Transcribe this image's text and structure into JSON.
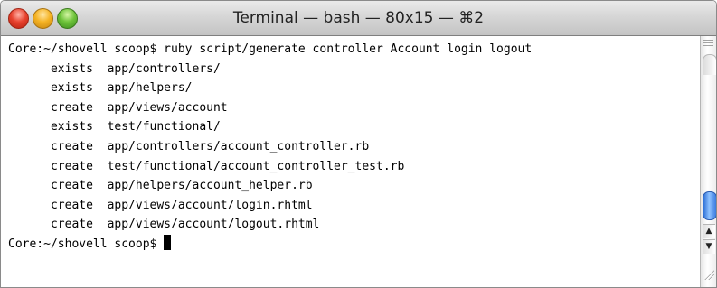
{
  "window": {
    "title": "Terminal — bash — 80x15 — ⌘2"
  },
  "terminal": {
    "lines": [
      "Core:~/shovell scoop$ ruby script/generate controller Account login logout",
      "      exists  app/controllers/",
      "      exists  app/helpers/",
      "      create  app/views/account",
      "      exists  test/functional/",
      "      create  app/controllers/account_controller.rb",
      "      create  test/functional/account_controller_test.rb",
      "      create  app/helpers/account_helper.rb",
      "      create  app/views/account/login.rhtml",
      "      create  app/views/account/logout.rhtml"
    ],
    "prompt": "Core:~/shovell scoop$ "
  },
  "scrollbar": {
    "up_arrow": "▲",
    "down_arrow": "▼",
    "position_fraction": 0.78
  },
  "icons": [
    "close-icon",
    "minimize-icon",
    "zoom-icon",
    "split-pane-icon",
    "resize-grip-icon"
  ]
}
